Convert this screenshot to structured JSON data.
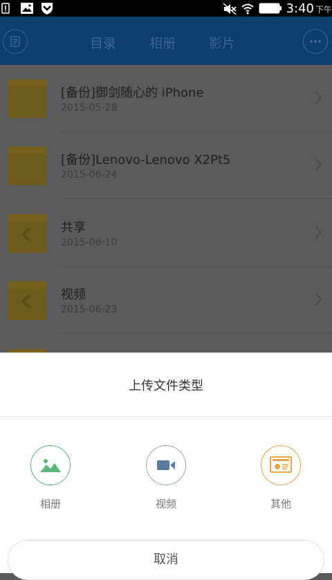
{
  "status_bar": {
    "time": "3:40",
    "ampm": "下午"
  },
  "header": {
    "tabs": [
      "目录",
      "相册",
      "影片"
    ]
  },
  "list": [
    {
      "title": "[备份]御剑随心的 iPhone",
      "date": "2015-05-28"
    },
    {
      "title": "[备份]Lenovo-Lenovo X2Pt5",
      "date": "2015-06-24"
    },
    {
      "title": "共享",
      "date": "2015-06-10"
    },
    {
      "title": "视频",
      "date": "2015-06-23"
    }
  ],
  "upload_sheet": {
    "title": "上传文件类型",
    "options": [
      {
        "label": "相册",
        "icon": "image-icon",
        "color": "#5cb87a"
      },
      {
        "label": "视频",
        "icon": "video-camera-icon",
        "color": "#5b7a9c"
      },
      {
        "label": "其他",
        "icon": "document-icon",
        "color": "#e8a24a"
      }
    ],
    "cancel_label": "取消"
  },
  "colors": {
    "appbar": "#1a6fc4",
    "overlay": "rgba(0,0,0,0.6)"
  }
}
